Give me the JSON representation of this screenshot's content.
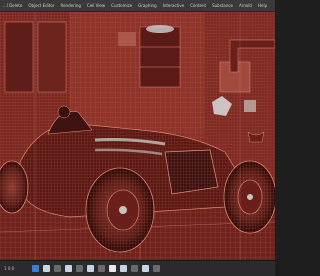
{
  "menubar": {
    "items": [
      "...l Delete",
      "Object Editor",
      "Rendering",
      "Cell View",
      "Customize",
      "Graphing",
      "Interactive",
      "Content",
      "Substance",
      "Arnold",
      "Help"
    ]
  },
  "viewport": {
    "view": "perspective",
    "scene": "vintage race car in workshop",
    "shading": "wireframe on shaded",
    "colors": {
      "base": "#7a2a24",
      "wire": "#e07a68",
      "dark": "#3e1210",
      "grid_line": "#c86b57"
    }
  },
  "statusbar": {
    "readout": "1 0:0",
    "tools": [
      {
        "name": "select-tool-icon",
        "color": "blue"
      },
      {
        "name": "move-tool-icon",
        "color": "light"
      },
      {
        "name": "rotate-tool-icon",
        "color": "grey"
      },
      {
        "name": "scale-tool-icon",
        "color": "light"
      },
      {
        "name": "snap-grid-icon",
        "color": "grey"
      },
      {
        "name": "snap-curve-icon",
        "color": "light"
      },
      {
        "name": "snap-point-icon",
        "color": "grey"
      },
      {
        "name": "render-icon",
        "color": "white"
      },
      {
        "name": "render-settings-icon",
        "color": "light"
      },
      {
        "name": "hypershade-icon",
        "color": "grey"
      },
      {
        "name": "outliner-icon",
        "color": "light"
      },
      {
        "name": "attribute-editor-icon",
        "color": "grey"
      }
    ]
  }
}
